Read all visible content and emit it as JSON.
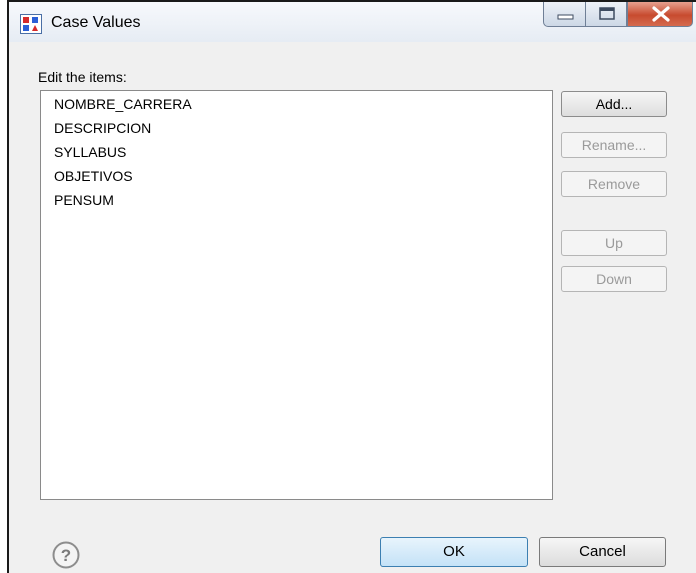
{
  "window": {
    "title": "Case Values"
  },
  "dialog": {
    "edit_label": "Edit the items:",
    "items": [
      "NOMBRE_CARRERA",
      "DESCRIPCION",
      "SYLLABUS",
      "OBJETIVOS",
      "PENSUM"
    ],
    "buttons": {
      "add": "Add...",
      "rename": "Rename...",
      "remove": "Remove",
      "up": "Up",
      "down": "Down"
    },
    "footer": {
      "ok": "OK",
      "cancel": "Cancel"
    }
  },
  "icons": {
    "app": "palette-icon",
    "help": "help-icon",
    "minimize": "minimize-icon",
    "maximize": "maximize-icon",
    "close": "close-icon"
  },
  "colors": {
    "close_button": "#c74b2f",
    "default_button_border": "#3c7fb1"
  }
}
